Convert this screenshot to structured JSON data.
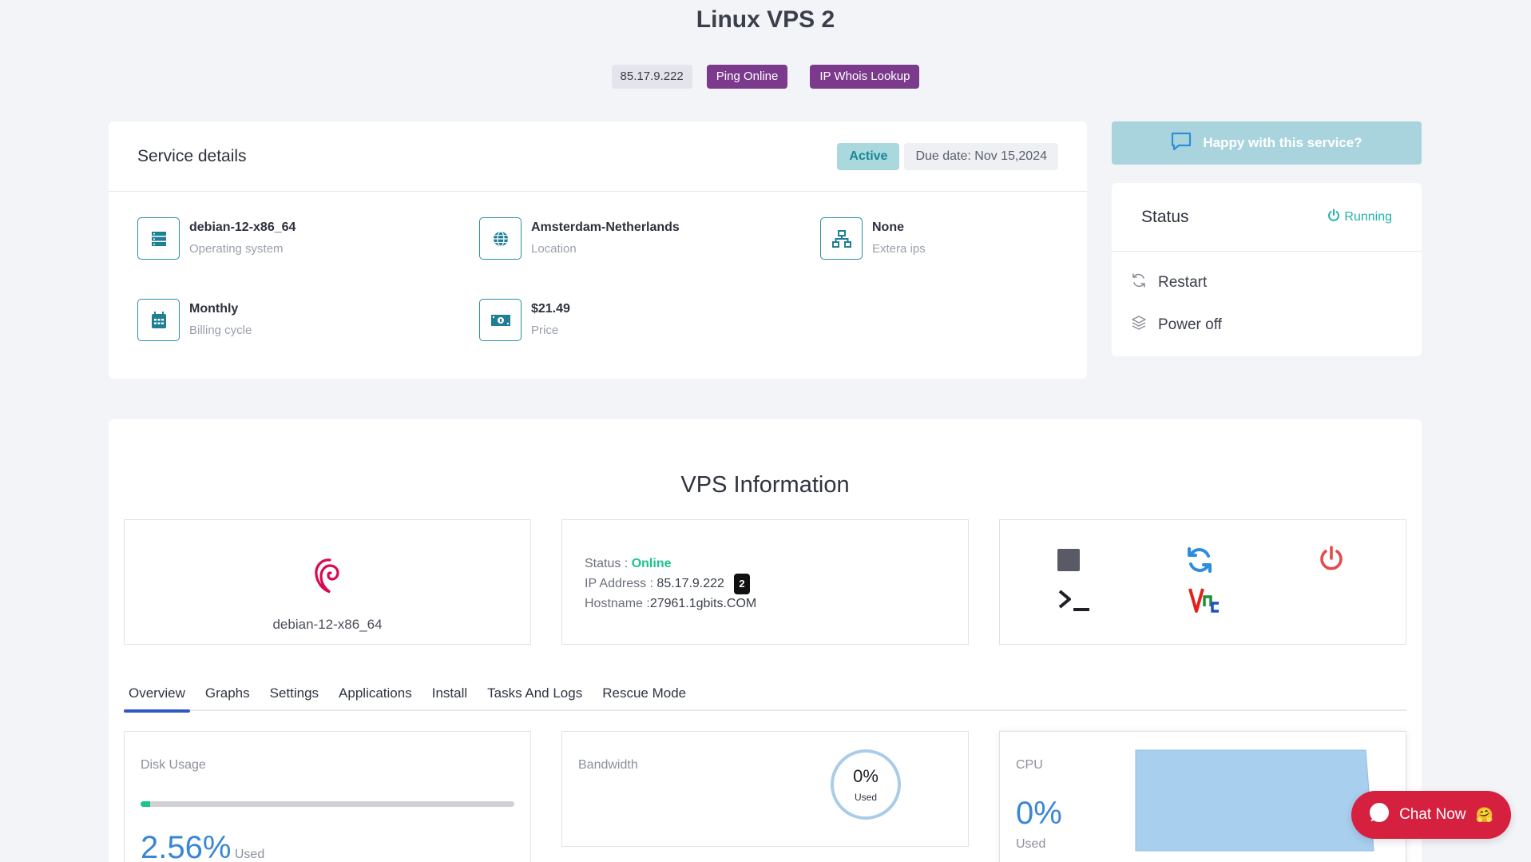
{
  "page": {
    "title": "Linux VPS 2"
  },
  "ip_bar": {
    "ip": "85.17.9.222",
    "ping_label": "Ping Online",
    "whois_label": "IP Whois Lookup"
  },
  "service": {
    "title": "Service details",
    "status_badge": "Active",
    "due_date": "Due date: Nov 15,2024",
    "items": [
      {
        "value": "debian-12-x86_64",
        "label": "Operating system",
        "icon": "server-icon"
      },
      {
        "value": "Amsterdam-Netherlands",
        "label": "Location",
        "icon": "globe-icon"
      },
      {
        "value": "None",
        "label": "Extera ips",
        "icon": "network-icon"
      },
      {
        "value": "Monthly",
        "label": "Billing cycle",
        "icon": "calendar-icon"
      },
      {
        "value": "$21.49",
        "label": "Price",
        "icon": "money-icon"
      }
    ]
  },
  "feedback": {
    "label": "Happy with this service?"
  },
  "status_panel": {
    "title": "Status",
    "state": "Running",
    "actions": [
      {
        "label": "Restart",
        "icon": "refresh-icon"
      },
      {
        "label": "Power off",
        "icon": "layers-icon"
      }
    ]
  },
  "vps_info": {
    "title": "VPS Information",
    "os_name": "debian-12-x86_64",
    "status_label": "Status : ",
    "status_value": "Online",
    "ip_label": "IP Address : ",
    "ip_value": "85.17.9.222",
    "ip_count": "2",
    "hostname_label": "Hostname :",
    "hostname_value": "27961.1gbits.COM"
  },
  "tabs": [
    "Overview",
    "Graphs",
    "Settings",
    "Applications",
    "Install",
    "Tasks And Logs",
    "Rescue Mode"
  ],
  "stats": {
    "disk": {
      "label": "Disk Usage",
      "percent": "2.56%",
      "percent_value": 2.56,
      "used": "Used"
    },
    "bandwidth": {
      "label": "Bandwidth",
      "percent": "0%",
      "used": "Used"
    },
    "cpu": {
      "label": "CPU",
      "percent": "0%",
      "used": "Used"
    }
  },
  "chat": {
    "label": "Chat Now",
    "emoji": "🤗"
  },
  "colors": {
    "accent_purple": "#7b3a8c",
    "teal": "#1f7f95",
    "online_green": "#1cc48a",
    "chat_red": "#d6203f",
    "blue_pct": "#3a86d6"
  }
}
